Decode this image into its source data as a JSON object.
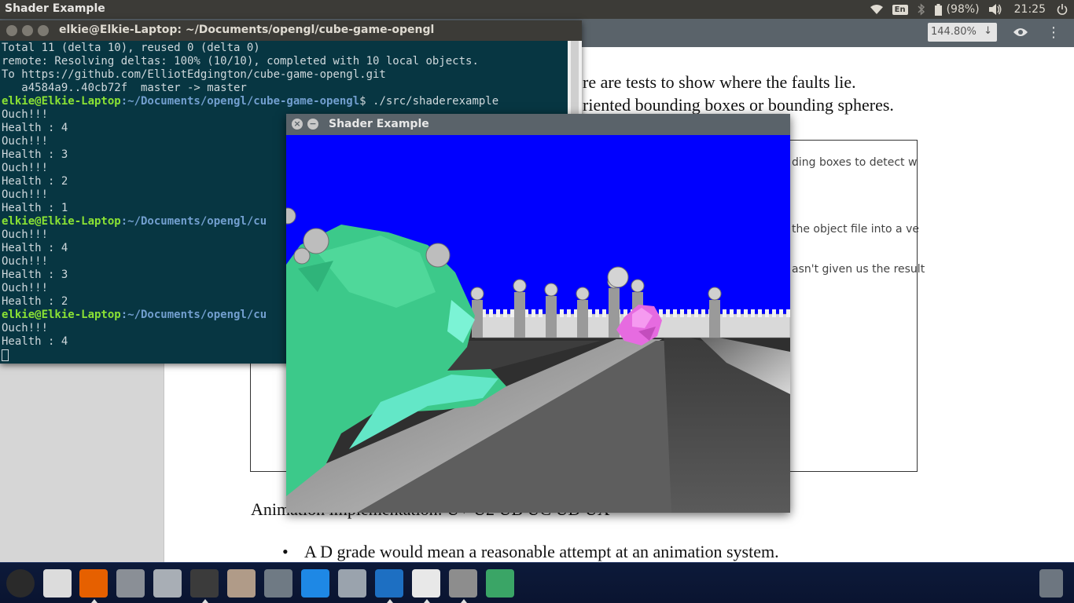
{
  "top_panel": {
    "app_title": "Shader Example",
    "keyboard_layout": "En",
    "battery": "(98%)",
    "clock": "21:25"
  },
  "doc_viewer": {
    "zoom": "144.80%",
    "lines": [
      "re are tests to show where the faults lie.",
      "riented bounding boxes or bounding spheres."
    ],
    "frame_lines": [
      "ding boxes to detect w",
      "the object file into a ve",
      "asn't given us the result"
    ],
    "heading": "Animation implementation: U+ U2 UB UC UD UX",
    "bullet": "A D grade would mean a reasonable attempt at an animation system."
  },
  "terminal": {
    "title": "elkie@Elkie-Laptop: ~/Documents/opengl/cube-game-opengl",
    "lines": [
      {
        "text": "Total 11 (delta 10), reused 0 (delta 0)"
      },
      {
        "text": "remote: Resolving deltas: 100% (10/10), completed with 10 local objects."
      },
      {
        "text": "To https://github.com/ElliotEdgington/cube-game-opengl.git"
      },
      {
        "text": "   a4584a9..40cb72f  master -> master"
      },
      {
        "user": "elkie@Elkie-Laptop",
        "path": ":~/Documents/opengl/cube-game-opengl",
        "cmd": "$ ./src/shaderexample"
      },
      {
        "text": "Ouch!!!"
      },
      {
        "text": "Health : 4"
      },
      {
        "text": "Ouch!!!"
      },
      {
        "text": "Health : 3"
      },
      {
        "text": "Ouch!!!"
      },
      {
        "text": "Health : 2"
      },
      {
        "text": "Ouch!!!"
      },
      {
        "text": "Health : 1"
      },
      {
        "user": "elkie@Elkie-Laptop",
        "path": ":~/Documents/opengl/cu",
        "cmd": ""
      },
      {
        "text": "Ouch!!!"
      },
      {
        "text": "Health : 4"
      },
      {
        "text": "Ouch!!!"
      },
      {
        "text": "Health : 3"
      },
      {
        "text": "Ouch!!!"
      },
      {
        "text": "Health : 2"
      },
      {
        "user": "elkie@Elkie-Laptop",
        "path": ":~/Documents/opengl/cu",
        "cmd": ""
      },
      {
        "text": "Ouch!!!"
      },
      {
        "text": "Health : 4"
      }
    ]
  },
  "shader_window": {
    "title": "Shader Example",
    "sky_color": "#0000ff",
    "player_color": "#3cc98a",
    "enemy_color": "#e66be0"
  },
  "launcher": {
    "apps": [
      {
        "name": "ubuntu-dash-icon",
        "color": "#2a2a2a"
      },
      {
        "name": "software-updater-icon",
        "color": "#dcdcdc"
      },
      {
        "name": "firefox-icon",
        "color": "#e66000"
      },
      {
        "name": "system-settings-icon",
        "color": "#8a8f96"
      },
      {
        "name": "files-icon",
        "color": "#a8aeb5"
      },
      {
        "name": "terminal-icon",
        "color": "#3b3b3b"
      },
      {
        "name": "archive-icon",
        "color": "#b09b88"
      },
      {
        "name": "screenshot-icon",
        "color": "#6f7a84"
      },
      {
        "name": "folder-blue-icon",
        "color": "#1e88e5"
      },
      {
        "name": "folder-grey-icon",
        "color": "#9aa3ad"
      },
      {
        "name": "brackets-icon",
        "color": "#1d6fc2"
      },
      {
        "name": "document-viewer-icon",
        "color": "#e8e8e8"
      },
      {
        "name": "unknown-app-icon",
        "color": "#8d8d8d"
      },
      {
        "name": "atom-icon",
        "color": "#3aa566"
      }
    ],
    "trash": "trash-icon"
  }
}
